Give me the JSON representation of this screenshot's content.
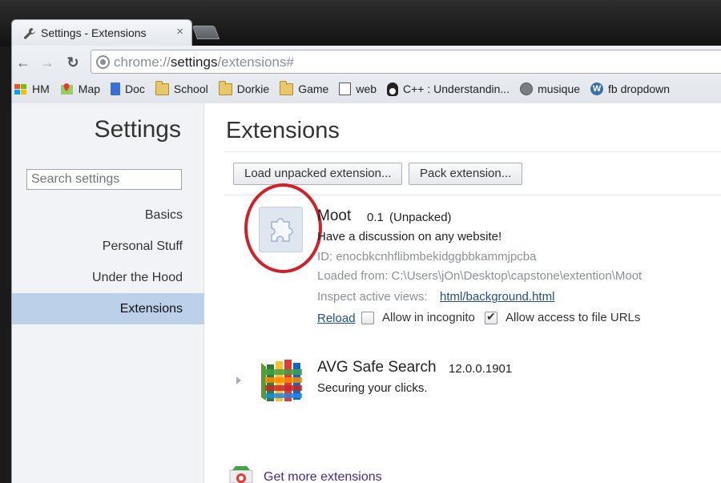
{
  "window": {
    "tab_title": "Settings - Extensions",
    "tab_close": "×"
  },
  "toolbar": {
    "back_icon": "←",
    "forward_icon": "→",
    "reload_icon": "↻",
    "url_scheme": "chrome://",
    "url_host": "settings",
    "url_path": "/extensions#"
  },
  "bookmarks": [
    {
      "label": "HM",
      "icon": "windows-icon"
    },
    {
      "label": "Map",
      "icon": "map-icon"
    },
    {
      "label": "Doc",
      "icon": "doc-icon"
    },
    {
      "label": "School",
      "icon": "folder-icon"
    },
    {
      "label": "Dorkie",
      "icon": "folder-icon"
    },
    {
      "label": "Game",
      "icon": "folder-icon"
    },
    {
      "label": "web",
      "icon": "web-icon"
    },
    {
      "label": "C++ : Understandin...",
      "icon": "tux-icon"
    },
    {
      "label": "musique",
      "icon": "globe-icon"
    },
    {
      "label": "fb dropdown",
      "icon": "wordpress-icon"
    }
  ],
  "sidebar": {
    "title": "Settings",
    "search_placeholder": "Search settings",
    "items": [
      {
        "label": "Basics"
      },
      {
        "label": "Personal Stuff"
      },
      {
        "label": "Under the Hood"
      },
      {
        "label": "Extensions",
        "active": true
      }
    ]
  },
  "main": {
    "title": "Extensions",
    "load_unpacked_label": "Load unpacked extension...",
    "pack_label": "Pack extension...",
    "extensions": [
      {
        "name": "Moot",
        "version": "0.1",
        "status": "(Unpacked)",
        "description": "Have a discussion on any website!",
        "id_line": "ID: enocbkcnhflibmbekidggbbkammjpcba",
        "loaded_from": "Loaded from: C:\\Users\\jOn\\Desktop\\capstone\\extention\\Moot",
        "inspect_label": "Inspect active views:",
        "inspect_link": "html/background.html",
        "reload_label": "Reload",
        "incognito_label": "Allow in incognito",
        "incognito_checked": false,
        "file_urls_label": "Allow access to file URLs",
        "file_urls_checked": true
      },
      {
        "name": "AVG Safe Search",
        "version": "12.0.0.1901",
        "description": "Securing your clicks."
      }
    ],
    "get_more_label": "Get more extensions"
  },
  "colors": {
    "annotation_circle": "#d0202a",
    "active_nav": "#bcd0ea",
    "link": "#1f4e8c"
  }
}
